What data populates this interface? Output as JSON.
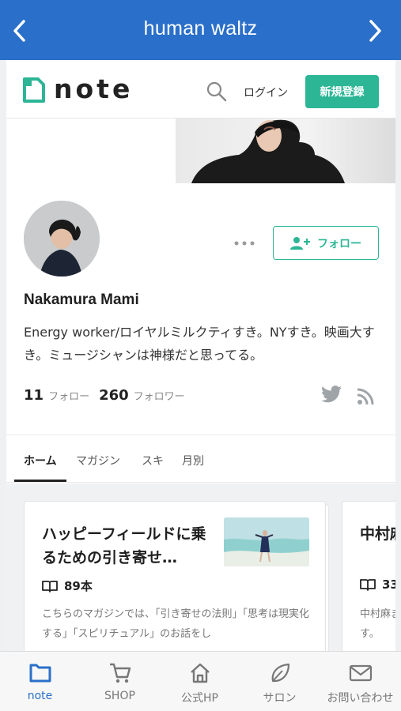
{
  "app": {
    "title": "human waltz"
  },
  "note_header": {
    "logo_text": "note",
    "login_label": "ログイン",
    "signup_label": "新規登録"
  },
  "profile": {
    "name": "Nakamura Mami",
    "bio": "Energy worker/ロイヤルミルクティすき。NYすき。映画大すき。ミュージシャンは神様だと思ってる。",
    "follow_label": "フォロー",
    "following_count": "11",
    "following_label": "フォロー",
    "follower_count": "260",
    "follower_label": "フォロワー"
  },
  "tabs": [
    {
      "label": "ホーム",
      "active": true
    },
    {
      "label": "マガジン",
      "active": false
    },
    {
      "label": "スキ",
      "active": false
    },
    {
      "label": "月別",
      "active": false
    }
  ],
  "magazines": [
    {
      "title": "ハッピーフィールドに乗るための引き寄せ…",
      "count": "89本",
      "description": "こちらのマガジンでは、「引き寄せの法則」「思考は現実化する」「スピリチュアル」のお話をし"
    },
    {
      "title": "中村麻",
      "count": "33",
      "description": "中村麻ます。"
    }
  ],
  "bottom_nav": [
    {
      "label": "note",
      "icon": "note-icon",
      "active": true
    },
    {
      "label": "SHOP",
      "icon": "cart-icon",
      "active": false
    },
    {
      "label": "公式HP",
      "icon": "home-icon",
      "active": false
    },
    {
      "label": "サロン",
      "icon": "leaf-icon",
      "active": false
    },
    {
      "label": "お問い合わせ",
      "icon": "mail-icon",
      "active": false
    }
  ],
  "colors": {
    "topbar": "#2a6fc9",
    "accent": "#2cb696",
    "active_nav": "#2a6fc9"
  }
}
